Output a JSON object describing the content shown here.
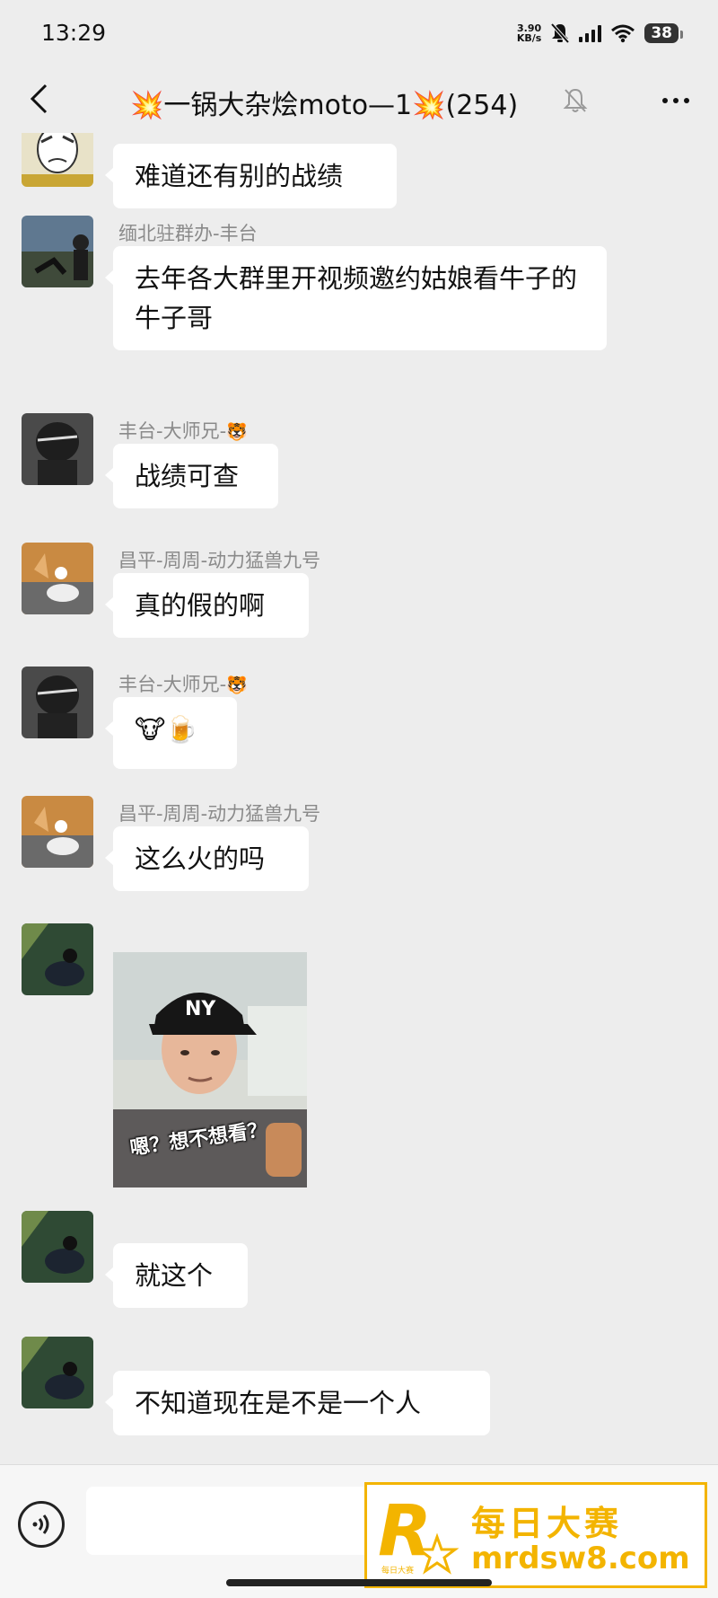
{
  "status_bar": {
    "time": "13:29",
    "net_speed_value": "3.90",
    "net_speed_unit": "KB/s",
    "battery": "38"
  },
  "header": {
    "title": "💥一锅大杂烩moto—1💥(254)",
    "back_icon": "chevron-left-icon",
    "mute_icon": "bell-off-icon",
    "more_icon": "more-dots-icon"
  },
  "messages": [
    {
      "sender": "",
      "text": "难道还有别的战绩"
    },
    {
      "sender": "缅北驻群办-丰台",
      "text": "去年各大群里开视频邀约姑娘看牛子的牛子哥"
    },
    {
      "sender": "丰台-大师兄-",
      "sender_emoji": "🐯",
      "text": "战绩可查"
    },
    {
      "sender": "昌平-周周-动力猛兽九号",
      "text": "真的假的啊"
    },
    {
      "sender": "丰台-大师兄-",
      "sender_emoji": "🐯",
      "text": "🐮🍺"
    },
    {
      "sender": "昌平-周周-动力猛兽九号",
      "text": "这么火的吗"
    },
    {
      "sender": "",
      "image_caption": "嗯？想不想看？",
      "cap_text": "NY"
    },
    {
      "sender": "",
      "text": "就这个"
    },
    {
      "sender": "",
      "text": "不知道现在是不是一个人"
    }
  ],
  "input_bar": {
    "placeholder": "",
    "voice_icon": "voice-icon",
    "emoji_icon": "emoji-smile-icon",
    "plus_icon": "plus-circle-icon"
  },
  "watermark": {
    "logo_letter": "R",
    "logo_small": "每日大赛",
    "name": "每日大赛",
    "url": "mrdsw8.com",
    "color": "#f3b400"
  }
}
